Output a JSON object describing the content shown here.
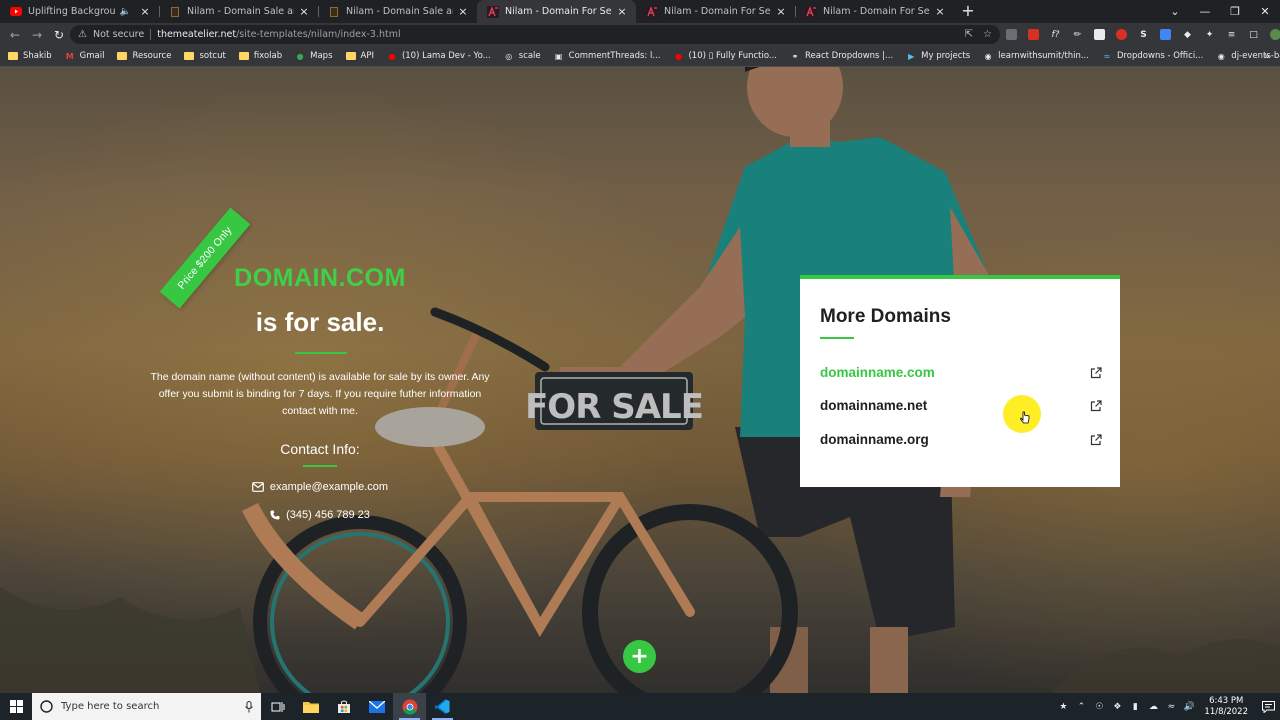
{
  "browser": {
    "tabs": [
      {
        "title": "Uplifting Background Music",
        "favicon": "youtube-icon",
        "audio": true,
        "active": false
      },
      {
        "title": "Nilam - Domain Sale and Auction",
        "favicon": "nilam-icon",
        "audio": false,
        "active": false
      },
      {
        "title": "Nilam - Domain Sale and Auction",
        "favicon": "nilam-icon",
        "audio": false,
        "active": false
      },
      {
        "title": "Nilam - Domain For Sell and Auc",
        "favicon": "themeatelier-icon",
        "audio": false,
        "active": true
      },
      {
        "title": "Nilam - Domain For Sell and Auc",
        "favicon": "themeatelier-icon",
        "audio": false,
        "active": false
      },
      {
        "title": "Nilam - Domain For Sell and Auc",
        "favicon": "themeatelier-icon",
        "audio": false,
        "active": false
      }
    ],
    "address": {
      "security_label": "Not secure",
      "host": "themeatelier.net",
      "path": "/site-templates/nilam/index-3.html"
    },
    "bookmarks": [
      {
        "label": "Shakib",
        "icon": "folder-icon"
      },
      {
        "label": "Gmail",
        "icon": "gmail-icon"
      },
      {
        "label": "Resource",
        "icon": "folder-icon"
      },
      {
        "label": "sotcut",
        "icon": "folder-icon"
      },
      {
        "label": "fixolab",
        "icon": "folder-icon"
      },
      {
        "label": "Maps",
        "icon": "maps-icon"
      },
      {
        "label": "API",
        "icon": "folder-icon"
      },
      {
        "label": "(10) Lama Dev - Yo...",
        "icon": "youtube-icon"
      },
      {
        "label": "scale",
        "icon": "scale-icon"
      },
      {
        "label": "CommentThreads: l...",
        "icon": "api-icon"
      },
      {
        "label": "(10) ▯ Fully Functio...",
        "icon": "youtube-icon"
      },
      {
        "label": "React Dropdowns |...",
        "icon": "react-icon"
      },
      {
        "label": "My projects",
        "icon": "project-icon"
      },
      {
        "label": "learnwithsumit/thin...",
        "icon": "github-icon"
      },
      {
        "label": "Dropdowns - Offici...",
        "icon": "mui-icon"
      },
      {
        "label": "dj-events-backend/...",
        "icon": "github-icon"
      }
    ]
  },
  "hero": {
    "ribbon": "Price $200 Only",
    "domain": "DOMAIN.COM",
    "subtitle": "is for sale.",
    "description": "The domain name (without content) is available for sale by its owner. Any offer you submit is binding for 7 days. If you require futher information contact with me.",
    "contact_title": "Contact Info:",
    "email": "example@example.com",
    "phone": "(345) 456 789 23"
  },
  "more_domains": {
    "title": "More Domains",
    "items": [
      {
        "name": "domainname.com",
        "highlight": true
      },
      {
        "name": "domainname.net",
        "highlight": false
      },
      {
        "name": "domainname.org",
        "highlight": false
      }
    ]
  },
  "fab_label": "+",
  "taskbar": {
    "search_placeholder": "Type here to search",
    "time": "6:43 PM",
    "date": "11/8/2022"
  },
  "colors": {
    "accent": "#37c743",
    "browser_dark": "#202124",
    "browser_toolbar": "#35363a",
    "taskbar": "#1c2329"
  }
}
